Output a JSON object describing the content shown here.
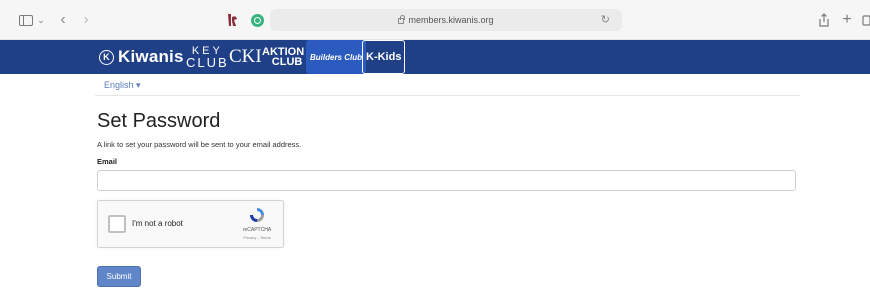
{
  "browser": {
    "url": "members.kiwanis.org"
  },
  "brands": {
    "kiwanis": "Kiwanis",
    "kiwanis_mark": "K",
    "keyclub_line1": "KEY",
    "keyclub_line2": "CLUB",
    "cki": "CKI",
    "aktion_line1": "AKTION",
    "aktion_line2": "CLUB",
    "builders": "Builders Club",
    "kkids": "K-Kids"
  },
  "language": {
    "selected": "English",
    "chevron": "▾"
  },
  "page": {
    "title": "Set Password",
    "info": "A link to set your password will be sent to your email address.",
    "email_label": "Email",
    "email_value": "",
    "submit_label": "Submit"
  },
  "recaptcha": {
    "label": "I'm not a robot",
    "brand": "reCAPTCHA",
    "links": "Privacy - Terms"
  },
  "colors": {
    "brand_bar": "#1f3f86",
    "link": "#5b7fc0",
    "submit": "#5e86c9"
  },
  "icons": {
    "sidebar": "sidebar-icon",
    "back": "chevron-left-icon",
    "forward": "chevron-right-icon",
    "lock": "lock-icon",
    "reload": "reload-icon",
    "share": "share-icon",
    "new_tab": "plus-icon",
    "tabs": "tabs-overview-icon"
  }
}
